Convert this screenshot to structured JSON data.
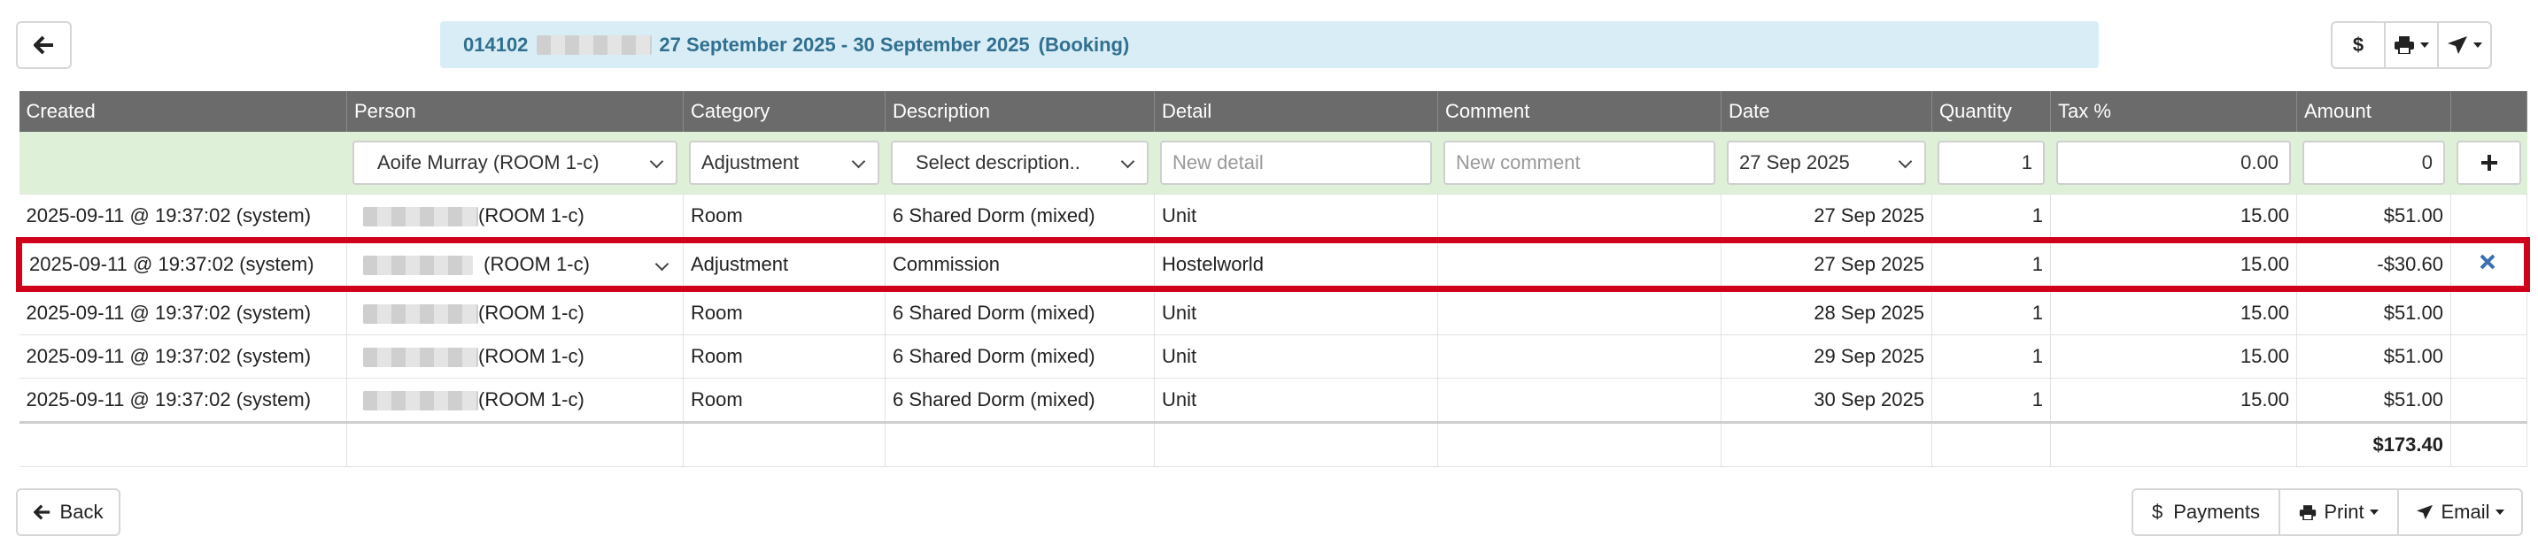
{
  "header": {
    "booking_id": "014102",
    "date_range": "27 September 2025 - 30 September 2025",
    "booking_type": "(Booking)",
    "dollar_label": "$"
  },
  "table": {
    "columns": [
      "Created",
      "Person",
      "Category",
      "Description",
      "Detail",
      "Comment",
      "Date",
      "Quantity",
      "Tax %",
      "Amount",
      ""
    ],
    "new_row": {
      "person": "Aoife Murray (ROOM 1-c)",
      "category": "Adjustment",
      "description_placeholder": "Select description..",
      "detail_placeholder": "New detail",
      "comment_placeholder": "New comment",
      "date": "27 Sep 2025",
      "quantity": "1",
      "tax": "0.00",
      "amount": "0"
    },
    "rows": [
      {
        "created": "2025-09-11 @ 19:37:02 (system)",
        "person_suffix": "(ROOM 1-c)",
        "category": "Room",
        "description": "6 Shared Dorm (mixed)",
        "detail": "Unit",
        "comment": "",
        "date": "27 Sep 2025",
        "quantity": "1",
        "tax": "15.00",
        "amount": "$51.00"
      },
      {
        "created": "2025-09-11 @ 19:37:02 (system)",
        "person_suffix": "(ROOM 1-c)",
        "category": "Adjustment",
        "description": "Commission",
        "detail": "Hostelworld",
        "comment": "",
        "date": "27 Sep 2025",
        "quantity": "1",
        "tax": "15.00",
        "amount": "-$30.60"
      },
      {
        "created": "2025-09-11 @ 19:37:02 (system)",
        "person_suffix": "(ROOM 1-c)",
        "category": "Room",
        "description": "6 Shared Dorm (mixed)",
        "detail": "Unit",
        "comment": "",
        "date": "28 Sep 2025",
        "quantity": "1",
        "tax": "15.00",
        "amount": "$51.00"
      },
      {
        "created": "2025-09-11 @ 19:37:02 (system)",
        "person_suffix": "(ROOM 1-c)",
        "category": "Room",
        "description": "6 Shared Dorm (mixed)",
        "detail": "Unit",
        "comment": "",
        "date": "29 Sep 2025",
        "quantity": "1",
        "tax": "15.00",
        "amount": "$51.00"
      },
      {
        "created": "2025-09-11 @ 19:37:02 (system)",
        "person_suffix": "(ROOM 1-c)",
        "category": "Room",
        "description": "6 Shared Dorm (mixed)",
        "detail": "Unit",
        "comment": "",
        "date": "30 Sep 2025",
        "quantity": "1",
        "tax": "15.00",
        "amount": "$51.00"
      }
    ],
    "total": "$173.40"
  },
  "footer": {
    "back_label": "Back",
    "payments_label": "Payments",
    "print_label": "Print",
    "email_label": "Email"
  },
  "colors": {
    "header_bg": "#6b6b6b",
    "new_row_bg": "#dff0d8",
    "title_bg": "#d9edf7",
    "highlight": "#d0021b",
    "delete_icon": "#3a6fb0"
  }
}
